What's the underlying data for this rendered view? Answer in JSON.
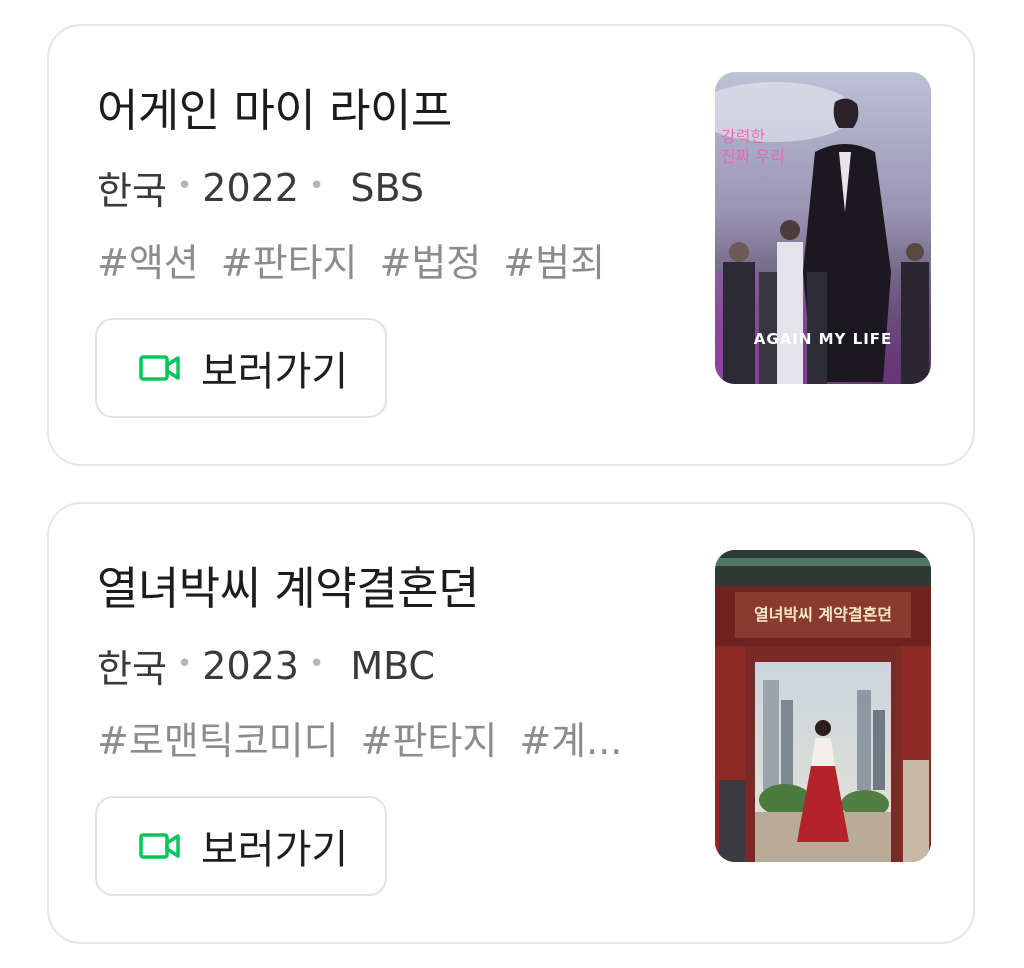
{
  "items": [
    {
      "title": "어게인 마이 라이프",
      "country": "한국",
      "year": "2022",
      "network": "SBS",
      "tags": [
        "#액션",
        "#판타지",
        "#법정",
        "#범죄"
      ],
      "watch_label": "보러가기",
      "poster_text": "AGAIN MY LIFE",
      "watch_icon": "video-camera-icon",
      "poster_alt": "어게인 마이 라이프 poster"
    },
    {
      "title": "열녀박씨 계약결혼뎐",
      "country": "한국",
      "year": "2023",
      "network": "MBC",
      "tags": [
        "#로맨틱코미디",
        "#판타지",
        "#계..."
      ],
      "watch_label": "보러가기",
      "poster_text": "열녀박씨 계약결혼뎐",
      "watch_icon": "video-camera-icon",
      "poster_alt": "열녀박씨 계약결혼뎐 poster"
    }
  ],
  "colors": {
    "accent": "#03c75a",
    "card_border": "#e6e6e6",
    "tag_text": "#8c8c8c"
  }
}
